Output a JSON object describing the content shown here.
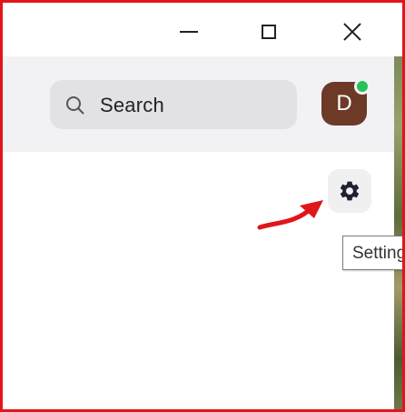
{
  "window_controls": {
    "minimize": "minimize-icon",
    "maximize": "maximize-icon",
    "close": "close-icon"
  },
  "header": {
    "search": {
      "label": "Search",
      "icon": "search-icon"
    },
    "avatar": {
      "initial": "D",
      "color": "#6d3a28",
      "status_color": "#26c15b"
    }
  },
  "toolbar": {
    "settings_icon": "gear-icon"
  },
  "tooltip": {
    "text": "Settings"
  },
  "annotation": {
    "arrow_color": "#e0161b"
  }
}
